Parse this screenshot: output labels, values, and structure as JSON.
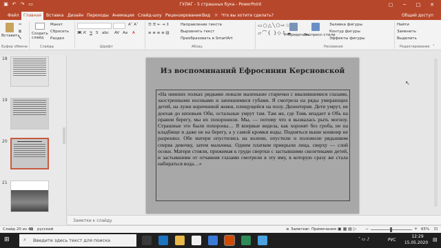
{
  "window": {
    "title": "ГУЛАГ - 5 страшных бука - PowerPoint"
  },
  "tabs": [
    "Файл",
    "Главная",
    "Вставка",
    "Дизайн",
    "Переходы",
    "Анимация",
    "Слайд-шоу",
    "Рецензирование",
    "Вид",
    "Что вы хотите сделать?"
  ],
  "account": "Общий доступ",
  "ribbon": {
    "paste": "Вставить",
    "create_slide": "Создать слайд",
    "layout": "Макет",
    "reset": "Сбросить",
    "section": "Раздел",
    "text_direction": "Направление текста",
    "align_text": "Выровнять текст",
    "smartart": "Преобразовать в SmartArt",
    "arrange": "Упорядочить",
    "quick_styles": "Экспресс-стили",
    "shape_fill": "Заливка фигуры",
    "shape_outline": "Контур фигуры",
    "shape_effects": "Эффекты фигуры",
    "find": "Найти",
    "replace": "Заменить",
    "select": "Выделить",
    "groups": {
      "clipboard": "Буфер обмена",
      "slides": "Слайды",
      "font": "Шрифт",
      "paragraph": "Абзац",
      "drawing": "Рисование",
      "editing": "Редактирование"
    }
  },
  "thumbs": [
    {
      "num": "18"
    },
    {
      "num": "19"
    },
    {
      "num": "20"
    },
    {
      "num": "21"
    }
  ],
  "slide": {
    "title": "Из воспоминаний Ефросинии Керсновской",
    "text": "«На нижних полках рядками лежали маленькие старички с ввалившимися глазами, заостренными носиками и запекшимися губами. Я смотрела на ряды умирающих детей, на лужи коричневой жижи, плещущейся на полу. Дизентерия. Дети умрут, не доехав до низовьев Оби, остальные умрут там. Там же, где Томь впадает в Обь на правом берегу, мы их похоронили. Мы, — потому что я вызвалась рыть могилу. Страшные это были похороны… Я впервые видела, как хоронят без гроба, не на кладбище и даже не на берегу, а у самой кромки воды. Подняться выше конвоир не разрешил. Обе матери опустились на колени, опустили и положили рядышком сперва девочку, затем мальчика. Одним платком прикрыли лица, сверху — слой осоки. Матери стояли, прижимая к груди свертки с застывшими скелетиками детей, и застывшими от отчаяния глазами смотрели в эту яму, в которую сразу же стала набираться вода…»"
  },
  "notes_placeholder": "Заметки к слайду",
  "status": {
    "slide_of": "Слайд 20 из 40",
    "language": "русский",
    "notes": "Заметки",
    "comments": "Примечания",
    "zoom": "65%"
  },
  "taskbar": {
    "search_placeholder": "Введите здесь текст для поиска",
    "lang": "РУС",
    "time": "12:29",
    "date": "15.05.2020"
  }
}
